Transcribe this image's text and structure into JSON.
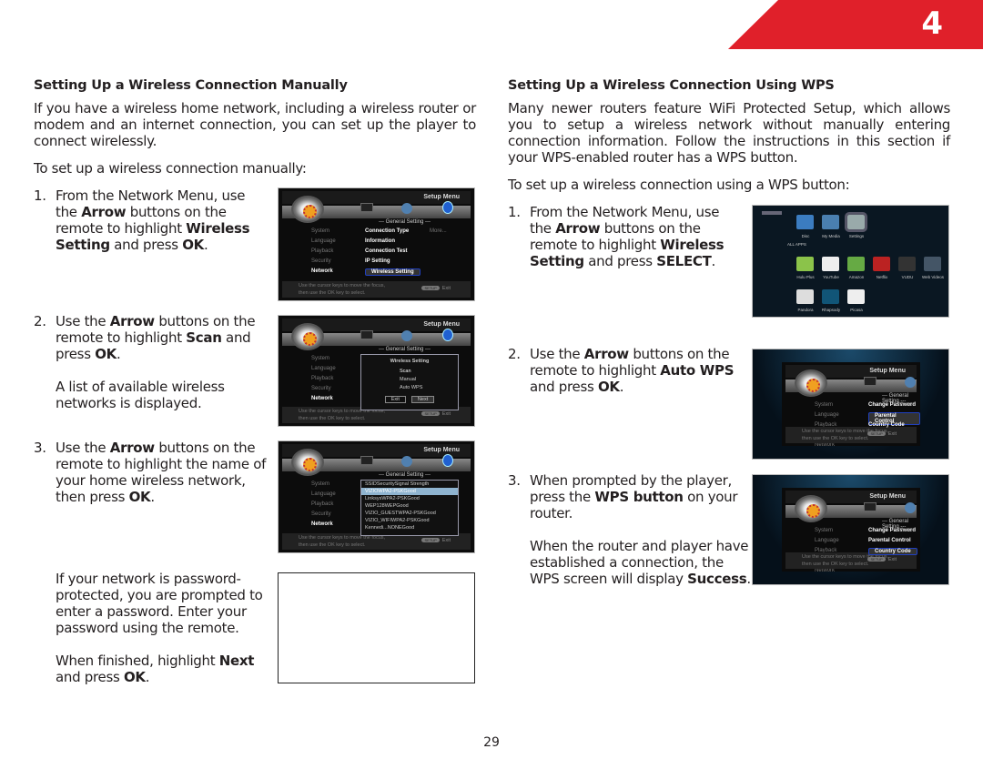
{
  "chapter": {
    "number": "4",
    "color": "#e0202a"
  },
  "page_number": "29",
  "left": {
    "heading": "Setting Up a Wireless Connection Manually",
    "intro": "If you have a wireless home network, including a wireless router or modem and an internet connection, you can set up the player to connect wirelessly.",
    "lead": "To set up a wireless connection manually:",
    "steps": [
      {
        "num": "1.",
        "t1": "From the Network Menu, use the ",
        "b1": "Arrow",
        "t2": " buttons on the remote to highlight ",
        "b2": "Wireless Setting",
        "t3": " and press ",
        "b3": "OK",
        "t4": "."
      },
      {
        "num": "2.",
        "t1": "Use the ",
        "b1": "Arrow",
        "t2": " buttons on the remote to highlight ",
        "b2": "Scan",
        "t3": " and press ",
        "b3": "OK",
        "t4": ".",
        "extra": "A list of available wireless networks is displayed."
      },
      {
        "num": "3.",
        "t1": "Use the ",
        "b1": "Arrow",
        "t2": " buttons on the remote to highlight the name of your home wireless network, then press ",
        "b2": "OK",
        "t3": "."
      }
    ],
    "password_note": "If your network is password-protected, you are prompted to enter a password. Enter your password using the remote.",
    "finish": {
      "t1": "When finished, highlight ",
      "b1": "Next",
      "t2": " and press ",
      "b2": "OK",
      "t3": "."
    }
  },
  "right": {
    "heading": "Setting Up a Wireless Connection Using WPS",
    "intro": "Many newer routers feature WiFi Protected Setup, which allows you to setup a wireless network without manually entering connection information. Follow the instructions in this section if your WPS-enabled router has a WPS button.",
    "lead": "To set up a wireless connection using a WPS button:",
    "steps": [
      {
        "num": "1.",
        "t1": "From the Network Menu, use the ",
        "b1": "Arrow",
        "t2": " buttons on the remote to highlight ",
        "b2": "Wireless Setting",
        "t3": " and press ",
        "b3": "SELECT",
        "t4": "."
      },
      {
        "num": "2.",
        "t1": "Use the ",
        "b1": "Arrow",
        "t2": " buttons on the remote to highlight ",
        "b2": "Auto WPS",
        "t3": " and press ",
        "b3": "OK",
        "t4": "."
      },
      {
        "num": "3.",
        "t1": "When prompted by the player, press the ",
        "b1": "WPS button",
        "t2": " on your router.",
        "extra1": "When the router and player have established a connection, the WPS screen will display ",
        "extra_b": "Success",
        "extra2": "."
      }
    ]
  },
  "screens": {
    "title": "Setup Menu",
    "section": "--- General Setting ---",
    "left_menu": [
      "System",
      "Language",
      "Playback",
      "Security",
      "Network"
    ],
    "footer1": "Use the cursor keys to move the focus,",
    "footer2": "then use the OK key to select.",
    "exit": "Exit",
    "more": "More...",
    "network_items": [
      "Connection Type",
      "Information",
      "Connection Test",
      "IP Setting",
      "Wireless Setting"
    ],
    "wireless_dialog": {
      "title": "Wireless Setting",
      "options": [
        "Scan",
        "Manual",
        "Auto WPS"
      ],
      "exit": "Exit",
      "next": "Next"
    },
    "network_list": {
      "headers": [
        "SSID",
        "Security",
        "Signal Strength"
      ],
      "rows": [
        [
          "VIZIO",
          "WPA2-PSK",
          "Good"
        ],
        [
          "Linksys",
          "WPA2-PSK",
          "Good"
        ],
        [
          "WEP128",
          "WEP",
          "Good"
        ],
        [
          "VIZIO_GUEST",
          "WPA2-PSK",
          "Good"
        ],
        [
          "VIZIO_WIFI",
          "WPA2-PSK",
          "Good"
        ],
        [
          "Kennedi...",
          "NONE",
          "Good"
        ]
      ]
    },
    "security_items": [
      "Change Password",
      "Parental Control",
      "Country Code"
    ],
    "home": {
      "top": [
        "Disc",
        "My Media",
        "Settings"
      ],
      "all_apps": "ALL APPS",
      "apps": [
        "Hulu Plus",
        "YouTube",
        "Amazon",
        "Netflix",
        "VUDU",
        "Web Videos",
        "Pandora",
        "Rhapsody",
        "Picasa"
      ]
    }
  }
}
